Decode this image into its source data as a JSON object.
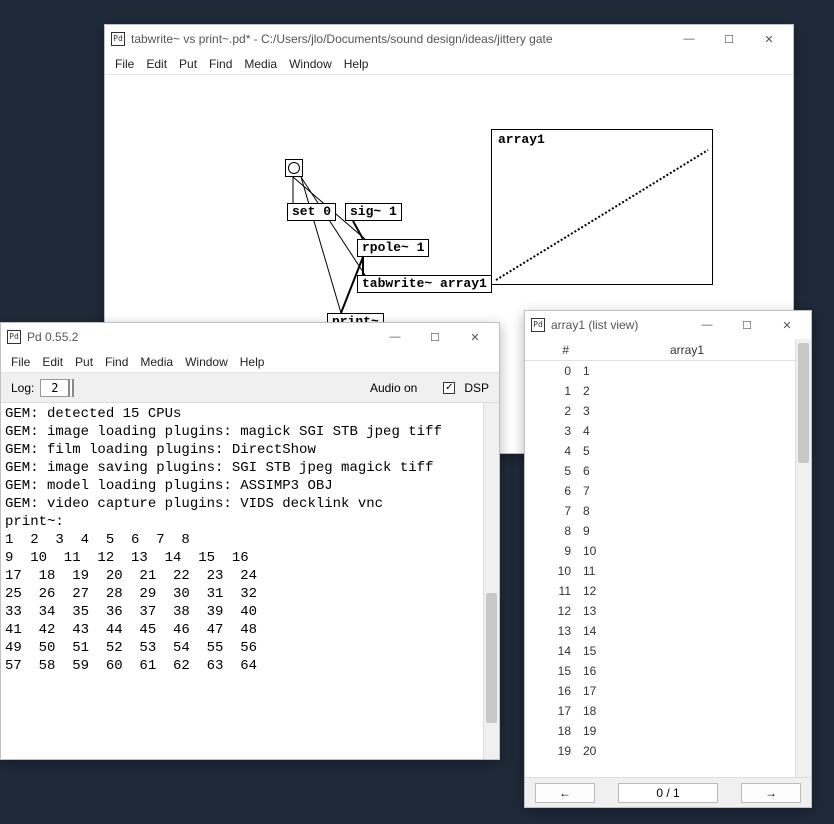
{
  "patch_window": {
    "title": "tabwrite~ vs print~.pd* - C:/Users/jlo/Documents/sound design/ideas/jittery gate",
    "menu": [
      "File",
      "Edit",
      "Put",
      "Find",
      "Media",
      "Window",
      "Help"
    ],
    "objects": {
      "set0": "set 0",
      "sig1": "sig~ 1",
      "rpole1": "rpole~ 1",
      "tabwrite": "tabwrite~ array1",
      "print": "print~",
      "array_label": "array1"
    }
  },
  "console_window": {
    "title": "Pd 0.55.2",
    "menu": [
      "File",
      "Edit",
      "Put",
      "Find",
      "Media",
      "Window",
      "Help"
    ],
    "log_label": "Log:",
    "log_value": "2",
    "audio_label": "Audio on",
    "dsp_label": "DSP",
    "dsp_checked": "✓",
    "text": "GEM: detected 15 CPUs\nGEM: image loading plugins: magick SGI STB jpeg tiff\nGEM: film loading plugins: DirectShow\nGEM: image saving plugins: SGI STB jpeg magick tiff\nGEM: model loading plugins: ASSIMP3 OBJ\nGEM: video capture plugins: VIDS decklink vnc\nprint~:\n1  2  3  4  5  6  7  8\n9  10  11  12  13  14  15  16\n17  18  19  20  21  22  23  24\n25  26  27  28  29  30  31  32\n33  34  35  36  37  38  39  40\n41  42  43  44  45  46  47  48\n49  50  51  52  53  54  55  56\n57  58  59  60  61  62  63  64"
  },
  "listview_window": {
    "title": "array1 (list view)",
    "header_idx": "#",
    "header_val": "array1",
    "rows": [
      {
        "i": "0",
        "v": "1"
      },
      {
        "i": "1",
        "v": "2"
      },
      {
        "i": "2",
        "v": "3"
      },
      {
        "i": "3",
        "v": "4"
      },
      {
        "i": "4",
        "v": "5"
      },
      {
        "i": "5",
        "v": "6"
      },
      {
        "i": "6",
        "v": "7"
      },
      {
        "i": "7",
        "v": "8"
      },
      {
        "i": "8",
        "v": "9"
      },
      {
        "i": "9",
        "v": "10"
      },
      {
        "i": "10",
        "v": "11"
      },
      {
        "i": "11",
        "v": "12"
      },
      {
        "i": "12",
        "v": "13"
      },
      {
        "i": "13",
        "v": "14"
      },
      {
        "i": "14",
        "v": "15"
      },
      {
        "i": "15",
        "v": "16"
      },
      {
        "i": "16",
        "v": "17"
      },
      {
        "i": "17",
        "v": "18"
      },
      {
        "i": "18",
        "v": "19"
      },
      {
        "i": "19",
        "v": "20"
      }
    ],
    "page": "0 / 1",
    "prev": "←",
    "next": "→"
  },
  "win_controls": {
    "min": "—",
    "max": "☐",
    "close": "✕"
  }
}
